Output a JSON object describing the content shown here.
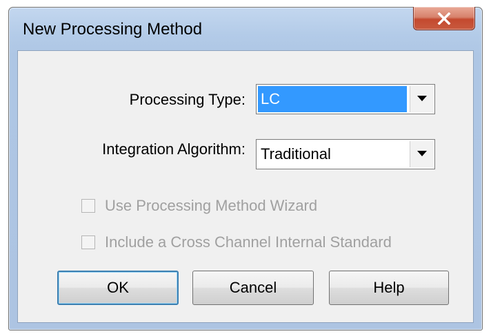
{
  "window": {
    "title": "New Processing Method"
  },
  "form": {
    "processing_type_label": "Processing Type:",
    "processing_type_value": "LC",
    "integration_algorithm_label": "Integration Algorithm:",
    "integration_algorithm_value": "Traditional",
    "use_wizard_label": "Use Processing Method Wizard",
    "use_wizard_checked": false,
    "use_wizard_enabled": false,
    "cross_channel_label": "Include a Cross Channel Internal Standard",
    "cross_channel_checked": false,
    "cross_channel_enabled": false
  },
  "buttons": {
    "ok": "OK",
    "cancel": "Cancel",
    "help": "Help"
  },
  "icons": {
    "close": "close-icon",
    "dropdown": "chevron-down-icon"
  },
  "colors": {
    "selection": "#3399ff",
    "close_button": "#c8503a",
    "disabled_text": "#a0a0a0"
  }
}
